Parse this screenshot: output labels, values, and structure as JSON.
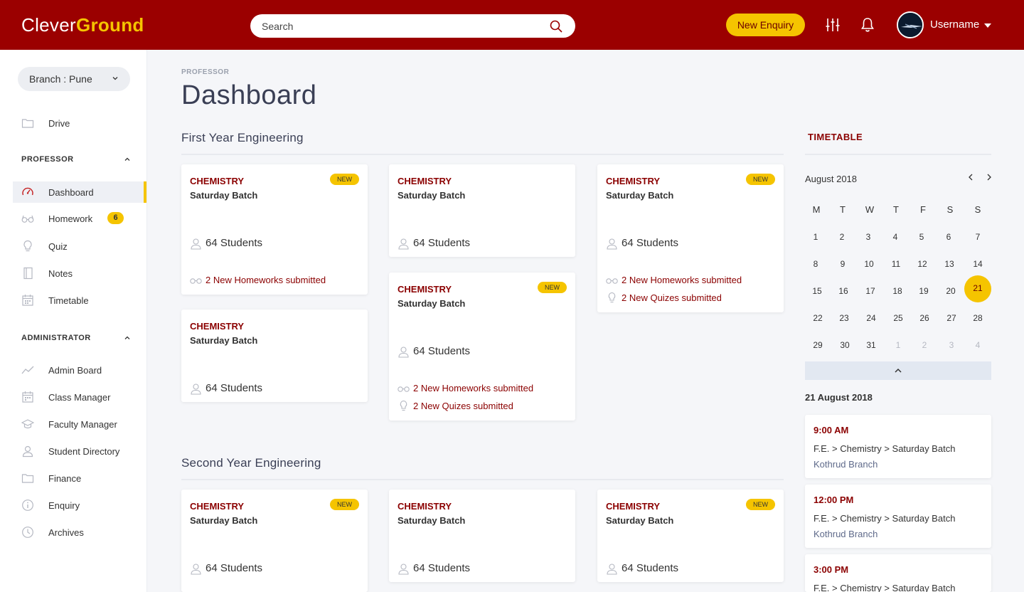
{
  "app": {
    "brand_left": "Clever",
    "brand_right": "Ground"
  },
  "topbar": {
    "search_placeholder": "Search",
    "enquiry_label": "New Enquiry",
    "username": "Username"
  },
  "sidebar": {
    "branch": "Branch : Pune",
    "drive": "Drive",
    "professor_section": "PROFESSOR",
    "professor_items": [
      {
        "label": "Dashboard",
        "icon": "gauge-icon"
      },
      {
        "label": "Homework",
        "icon": "glasses-icon",
        "badge": "6"
      },
      {
        "label": "Quiz",
        "icon": "lightbulb-icon"
      },
      {
        "label": "Notes",
        "icon": "notebook-icon"
      },
      {
        "label": "Timetable",
        "icon": "calendar-icon"
      }
    ],
    "admin_section": "ADMINISTRATOR",
    "admin_items": [
      {
        "label": "Admin Board",
        "icon": "trend-icon"
      },
      {
        "label": "Class Manager",
        "icon": "calendar-icon"
      },
      {
        "label": "Faculty Manager",
        "icon": "graduation-cap-icon"
      },
      {
        "label": "Student Directory",
        "icon": "users-icon"
      },
      {
        "label": "Finance",
        "icon": "folder-icon"
      },
      {
        "label": "Enquiry",
        "icon": "info-icon"
      },
      {
        "label": "Archives",
        "icon": "clock-icon"
      }
    ]
  },
  "main": {
    "breadcrumb": "PROFESSOR",
    "title": "Dashboard",
    "sections": [
      {
        "title": "First Year Engineering",
        "cards": [
          {
            "subject": "CHEMISTRY",
            "batch": "Saturday Batch",
            "new_badge": "NEW",
            "students": "64 Students",
            "activities": [
              "2 New Homeworks submitted"
            ]
          },
          {
            "subject": "CHEMISTRY",
            "batch": "Saturday Batch",
            "students": "64 Students",
            "activities": []
          },
          {
            "subject": "CHEMISTRY",
            "batch": "Saturday Batch",
            "new_badge": "NEW",
            "students": "64 Students",
            "activities": [
              "2 New Homeworks submitted",
              "2 New Quizes submitted"
            ]
          },
          {
            "subject": "CHEMISTRY",
            "batch": "Saturday Batch",
            "students": "64 Students",
            "activities": []
          },
          {
            "subject": "CHEMISTRY",
            "batch": "Saturday Batch",
            "new_badge": "NEW",
            "students": "64 Students",
            "activities": [
              "2 New Homeworks submitted",
              "2 New Quizes submitted"
            ]
          }
        ]
      },
      {
        "title": "Second Year Engineering",
        "cards": [
          {
            "subject": "CHEMISTRY",
            "batch": "Saturday Batch",
            "new_badge": "NEW",
            "students": "64 Students"
          },
          {
            "subject": "CHEMISTRY",
            "batch": "Saturday Batch",
            "students": "64 Students"
          },
          {
            "subject": "CHEMISTRY",
            "batch": "Saturday Batch",
            "new_badge": "NEW",
            "students": "64 Students"
          }
        ]
      }
    ]
  },
  "timetable": {
    "title": "TIMETABLE",
    "month": "August 2018",
    "weekdays": [
      "M",
      "T",
      "W",
      "T",
      "F",
      "S",
      "S"
    ],
    "weeks": [
      [
        "1",
        "2",
        "3",
        "4",
        "5",
        "6",
        "7"
      ],
      [
        "8",
        "9",
        "10",
        "11",
        "12",
        "13",
        "14"
      ],
      [
        "15",
        "16",
        "17",
        "18",
        "19",
        "20",
        "21"
      ],
      [
        "22",
        "23",
        "24",
        "25",
        "26",
        "27",
        "28"
      ],
      [
        "29",
        "30",
        "31",
        "1",
        "2",
        "3",
        "4"
      ]
    ],
    "selected_day": "21",
    "selected_date": "21 August 2018",
    "slots": [
      {
        "time": "9:00 AM",
        "path": "F.E. > Chemistry > Saturday Batch",
        "location": "Kothrud Branch"
      },
      {
        "time": "12:00 PM",
        "path": "F.E. > Chemistry > Saturday Batch",
        "location": "Kothrud Branch"
      },
      {
        "time": "3:00 PM",
        "path": "F.E. > Chemistry > Saturday Batch",
        "location": ""
      }
    ]
  },
  "colors": {
    "primary": "#9b0000",
    "accent": "#f5c400",
    "text_dark": "#3a3f55"
  }
}
